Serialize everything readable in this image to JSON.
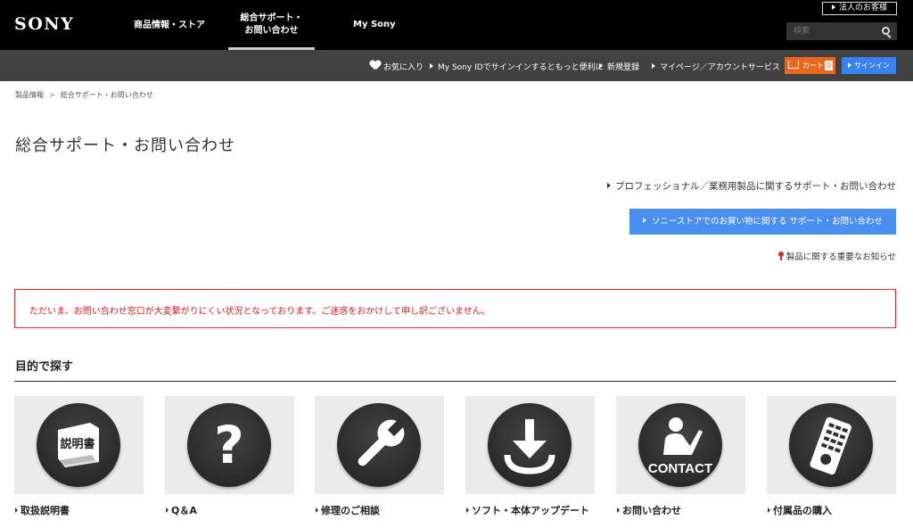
{
  "header": {
    "logo": "SONY",
    "nav": {
      "products": "商品情報・ストア",
      "support_line1": "総合サポート・",
      "support_line2": "お問い合わせ",
      "mysony": "My Sony"
    },
    "corporate": "法人のお客様",
    "search_placeholder": "検索"
  },
  "subnav": {
    "favorites": "お気に入り",
    "mysony_id": "My Sony IDでサインインするともっと便利に",
    "register": "新規登録",
    "mypage": "マイページ／アカウントサービス",
    "cart": "カート",
    "cart_count": "0",
    "signin": "サインイン"
  },
  "breadcrumb": {
    "item1": "製品情報",
    "sep": ">",
    "item2": "総合サポート・お問い合わせ"
  },
  "page_title": "総合サポート・お問い合わせ",
  "links": {
    "professional": "プロフェッショナル／業務用製品に関するサポート・お問い合わせ",
    "store": "ソニーストアでのお買い物に関する サポート・お問い合わせ",
    "notice": "製品に関する重要なお知らせ"
  },
  "alert": "ただいま、お問い合わせ窓口が大変繋がりにくい状況となっております。ご迷惑をおかけして申し訳ございません。",
  "section_title": "目的で探す",
  "cards": [
    {
      "label": "取扱説明書",
      "icon_text": "説明書"
    },
    {
      "label": "Q＆A",
      "icon_text": "?"
    },
    {
      "label": "修理のご相談",
      "icon_text": ""
    },
    {
      "label": "ソフト・本体アップデート",
      "icon_text": ""
    },
    {
      "label": "お問い合わせ",
      "icon_text": "CONTACT"
    },
    {
      "label": "付属品の購入",
      "icon_text": ""
    }
  ],
  "colors": {
    "accent_blue": "#4a8ff0",
    "cart_orange": "#e8691d",
    "alert_red": "#e02020"
  }
}
